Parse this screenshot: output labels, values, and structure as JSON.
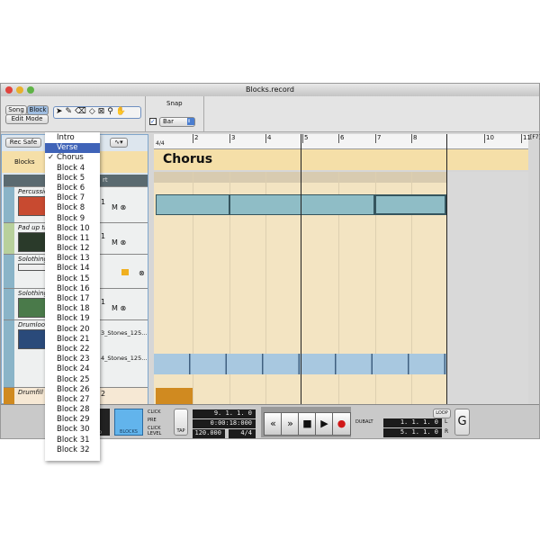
{
  "window": {
    "title": "Blocks.record"
  },
  "toolbar": {
    "song": "Song",
    "block": "Block",
    "edit_mode": "Edit Mode",
    "snap_label": "Snap",
    "snap_checked": true,
    "snap_value": "Bar",
    "tools": [
      "arrow-icon",
      "pencil-icon",
      "eraser-icon",
      "razor-icon",
      "mute-tool-icon",
      "magnifier-icon",
      "hand-icon"
    ]
  },
  "left": {
    "rec_safe": "Rec Safe",
    "blocks": "Blocks",
    "header_fragment": "rt",
    "tracks": [
      {
        "name": "Percussion",
        "lane": "1",
        "color": "#8ab4c8"
      },
      {
        "name": "Pad up th",
        "lane": "1",
        "color": "#b8d09c"
      },
      {
        "name": "Solothing",
        "lane": "",
        "color": "#8ab4c8"
      },
      {
        "name": "Solothing",
        "lane": "1",
        "color": "#8ab4c8"
      },
      {
        "name": "Drumloop",
        "lane": "3_Stones_125...",
        "lane2": "4_Stones_125...",
        "color": "#8ab4c8"
      },
      {
        "name": "Drumfill",
        "lane": "2",
        "color": "#d08a20"
      }
    ]
  },
  "ruler": {
    "signature": "4/4",
    "bars": [
      "2",
      "3",
      "4",
      "5",
      "6",
      "7",
      "8",
      "10",
      "11"
    ],
    "key": "[F7]"
  },
  "block_lane": {
    "current": "Chorus"
  },
  "menu": {
    "items": [
      "Intro",
      "Verse",
      "Chorus",
      "Block 4",
      "Block 5",
      "Block 6",
      "Block 7",
      "Block 8",
      "Block 9",
      "Block 10",
      "Block 11",
      "Block 12",
      "Block 13",
      "Block 14",
      "Block 15",
      "Block 16",
      "Block 17",
      "Block 18",
      "Block 19",
      "Block 20",
      "Block 21",
      "Block 22",
      "Block 23",
      "Block 24",
      "Block 25",
      "Block 26",
      "Block 27",
      "Block 28",
      "Block 29",
      "Block 30",
      "Block 31",
      "Block 32"
    ],
    "highlighted": "Verse",
    "checked": "Chorus"
  },
  "transport": {
    "blocks": "BLOCKS",
    "click": "CLICK",
    "pre": "PRE",
    "click_level": "CLICK LEVEL",
    "tap": "TAP",
    "position": "9. 1. 1.   0",
    "time": "0:00:18:000",
    "tempo": "120.000",
    "signature": "4/4",
    "dub": "DUB",
    "alt": "ALT",
    "loop": "LOOP",
    "left_loc": "1. 1. 1.   0",
    "right_loc": "5. 1. 1.   0",
    "L": "L",
    "R": "R",
    "solo": "SOLO"
  }
}
